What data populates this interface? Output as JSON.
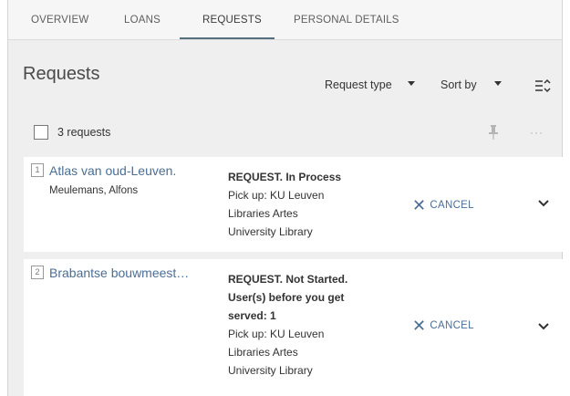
{
  "tabs": [
    {
      "label": "OVERVIEW"
    },
    {
      "label": "LOANS"
    },
    {
      "label": "REQUESTS"
    },
    {
      "label": "PERSONAL DETAILS"
    }
  ],
  "active_tab": "REQUESTS",
  "page_title": "Requests",
  "filters": {
    "request_type_label": "Request type",
    "sort_by_label": "Sort by"
  },
  "select_all": {
    "count_label": "3 requests"
  },
  "more_label": "···",
  "requests": [
    {
      "number": "1",
      "title": "Atlas van oud-Leuven.",
      "author": "Meulemans, Alfons",
      "status_lines": [
        "REQUEST. In Process",
        "Pick up: KU Leuven",
        "Libraries Artes",
        "University Library"
      ],
      "cancel_label": "CANCEL"
    },
    {
      "number": "2",
      "title": "Brabantse bouwmeest…",
      "author": "",
      "status_lines": [
        "REQUEST. Not Started.",
        "User(s) before you get",
        "served: 1",
        "Pick up: KU Leuven",
        "Libraries Artes",
        "University Library"
      ],
      "cancel_label": "CANCEL"
    }
  ],
  "colors": {
    "accent": "#4a6e96",
    "tab_underline": "#54707f",
    "background": "#efefef"
  },
  "icons": {
    "filter_caret": "caret-down-icon",
    "view_toggle": "list-sort-icon",
    "pin": "pin-icon",
    "more": "ellipsis-icon",
    "cancel": "close-icon",
    "expand": "chevron-down-icon"
  }
}
